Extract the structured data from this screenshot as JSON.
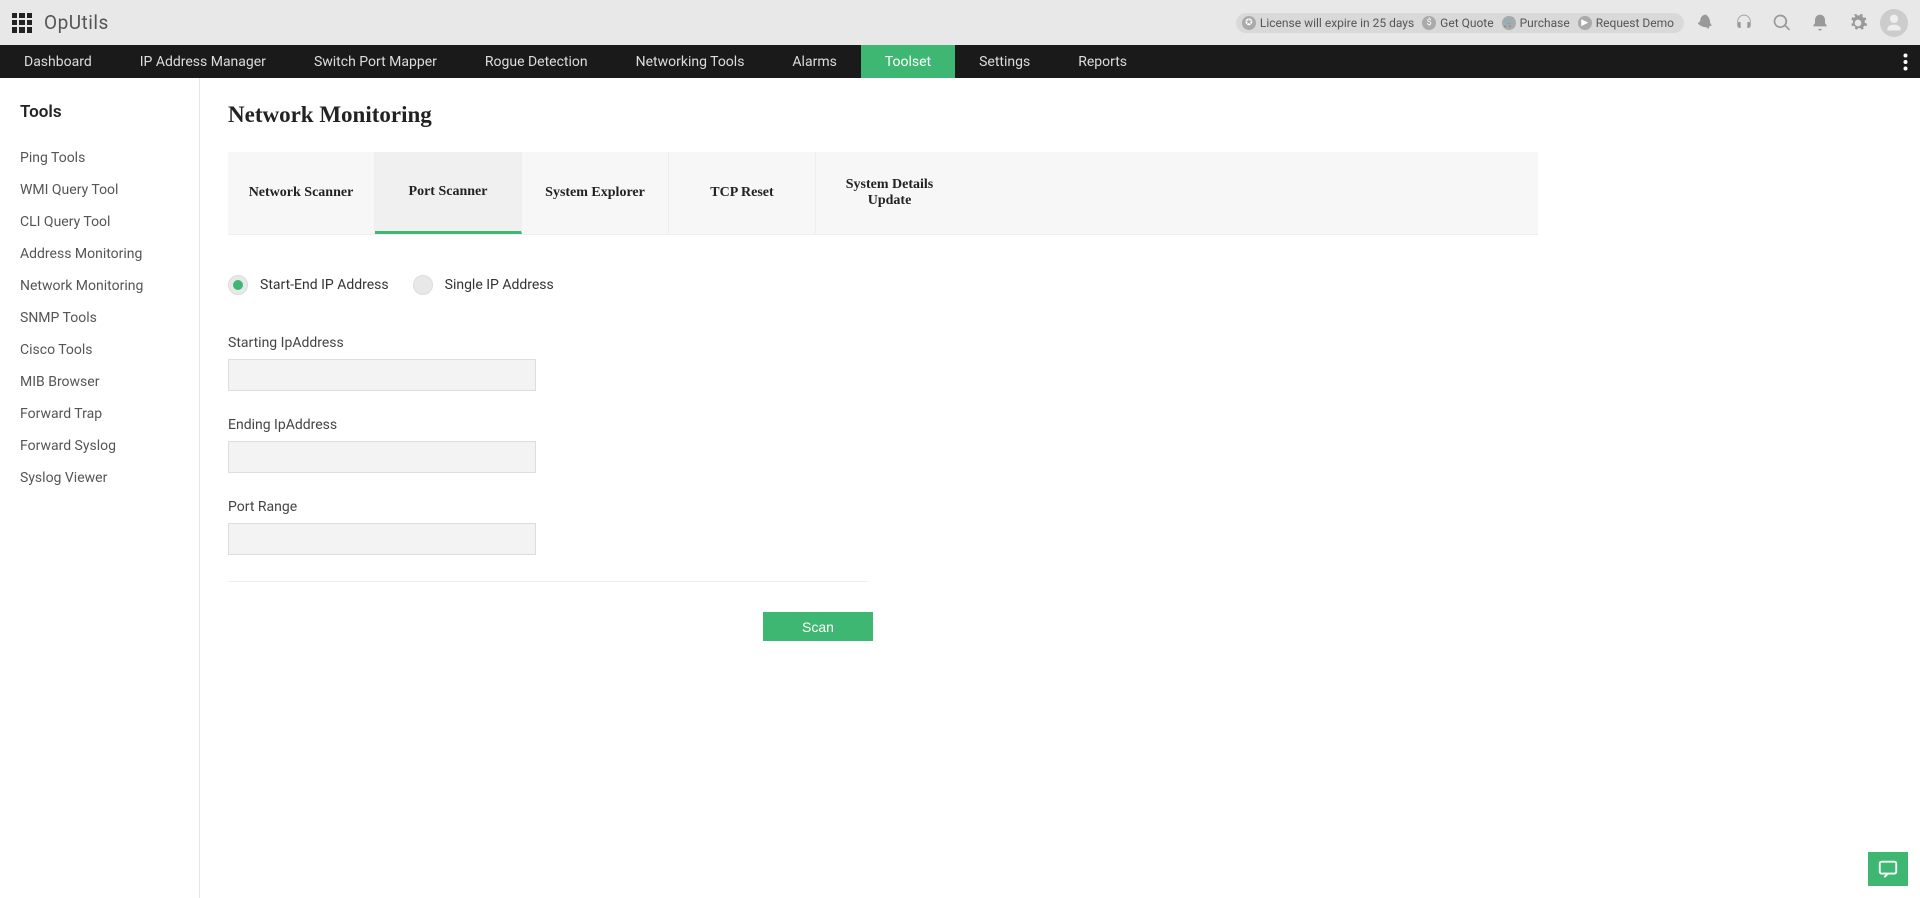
{
  "brand": "OpUtils",
  "license_bar": {
    "expire": "License will expire in 25 days",
    "quote": "Get Quote",
    "purchase": "Purchase",
    "demo": "Request Demo"
  },
  "nav": {
    "items": [
      "Dashboard",
      "IP Address Manager",
      "Switch Port Mapper",
      "Rogue Detection",
      "Networking Tools",
      "Alarms",
      "Toolset",
      "Settings",
      "Reports"
    ],
    "active_index": 6
  },
  "sidebar": {
    "title": "Tools",
    "items": [
      "Ping Tools",
      "WMI Query Tool",
      "CLI Query Tool",
      "Address Monitoring",
      "Network Monitoring",
      "SNMP Tools",
      "Cisco Tools",
      "MIB Browser",
      "Forward Trap",
      "Forward Syslog",
      "Syslog Viewer"
    ]
  },
  "page": {
    "title": "Network Monitoring",
    "tabs": [
      "Network Scanner",
      "Port Scanner",
      "System Explorer",
      "TCP Reset",
      "System Details Update"
    ],
    "active_tab_index": 1
  },
  "form": {
    "radio_start_end": "Start-End IP Address",
    "radio_single": "Single IP Address",
    "starting_label": "Starting IpAddress",
    "ending_label": "Ending IpAddress",
    "port_range_label": "Port Range",
    "starting_value": "",
    "ending_value": "",
    "port_range_value": "",
    "scan_label": "Scan"
  }
}
